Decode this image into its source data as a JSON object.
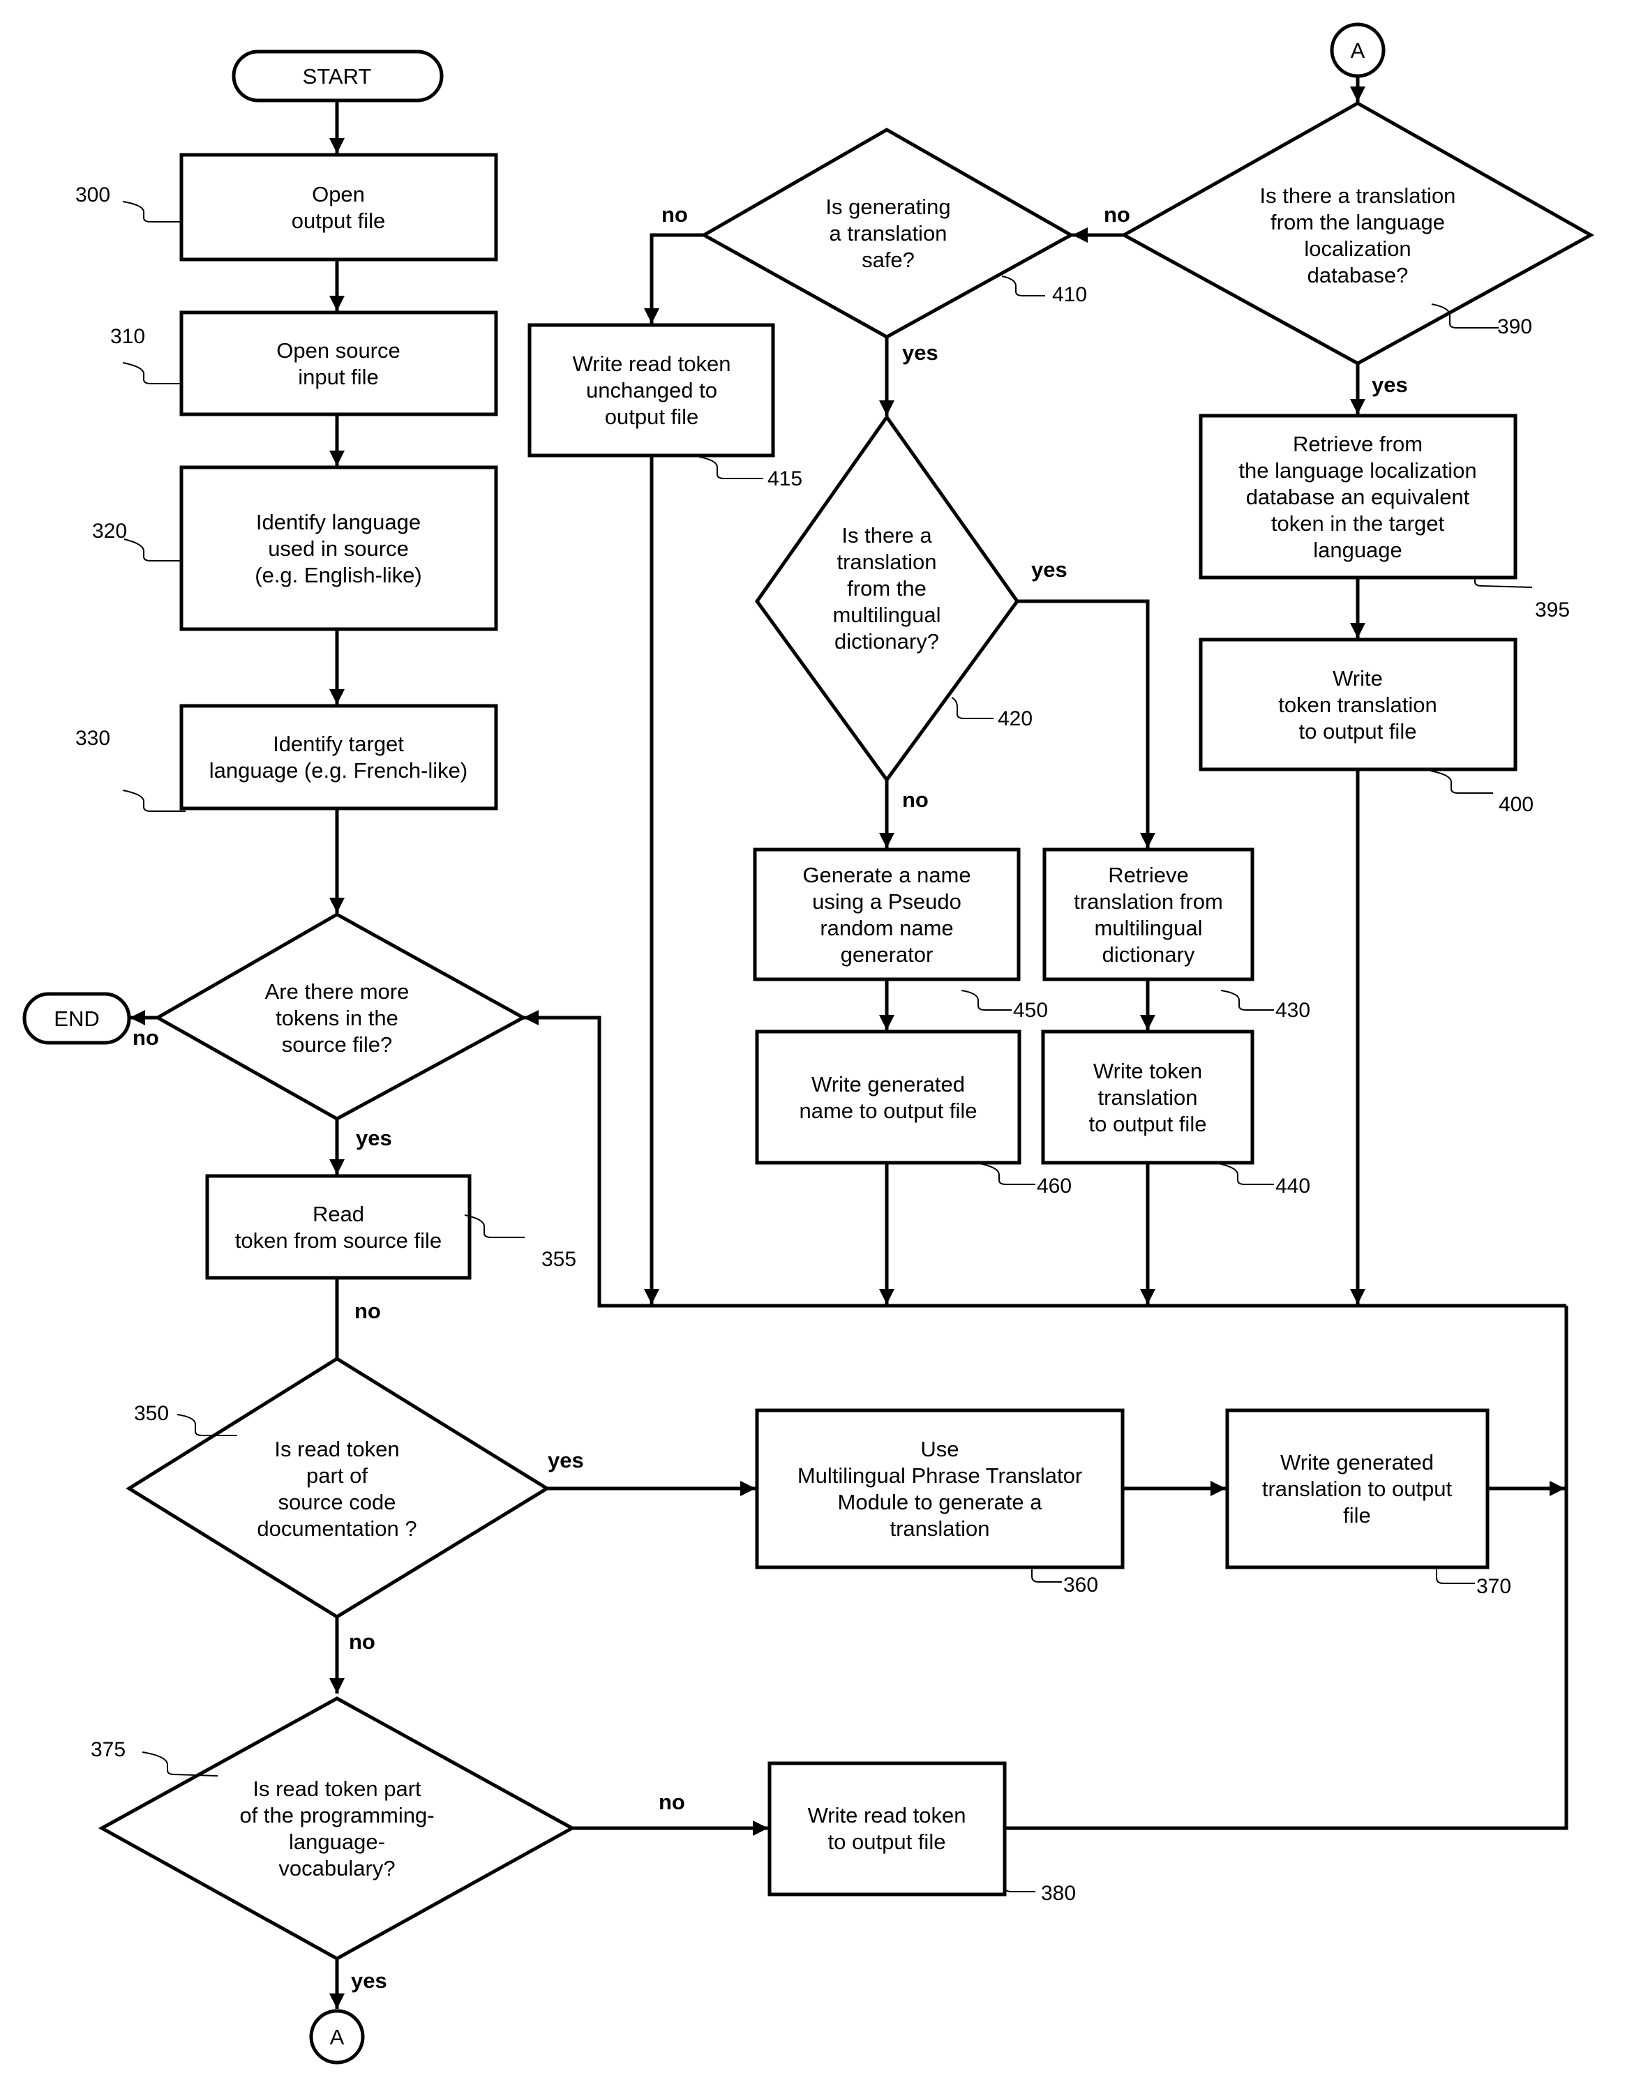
{
  "diagram": {
    "type": "flowchart",
    "colors": {
      "stroke": "#000000",
      "background": "#ffffff"
    },
    "terminals": {
      "start": "START",
      "end": "END",
      "connector_bottom": "A",
      "connector_top": "A"
    },
    "steps": {
      "s300": {
        "ref": "300",
        "lines": [
          "Open",
          "output file"
        ]
      },
      "s310": {
        "ref": "310",
        "lines": [
          "Open source",
          "input file"
        ]
      },
      "s320": {
        "ref": "320",
        "lines": [
          "Identify language",
          "used in source",
          "(e.g. English-like)"
        ]
      },
      "s330": {
        "ref": "330",
        "lines": [
          "Identify target",
          "language (e.g. French-like)"
        ]
      },
      "s340": {
        "ref": "",
        "lines": [
          "Are there more",
          "tokens in the",
          "source file?"
        ]
      },
      "s355": {
        "ref": "355",
        "lines": [
          "Read",
          "token from source file"
        ]
      },
      "s350": {
        "ref": "350",
        "lines": [
          "Is read token",
          "part of",
          "source code",
          "documentation ?"
        ]
      },
      "s360": {
        "ref": "360",
        "lines": [
          "Use",
          "Multilingual Phrase Translator",
          "Module to generate a",
          "translation"
        ]
      },
      "s370": {
        "ref": "370",
        "lines": [
          "Write generated",
          "translation to output",
          "file"
        ]
      },
      "s375": {
        "ref": "375",
        "lines": [
          "Is read token part",
          "of the programming-",
          "language-",
          "vocabulary?"
        ]
      },
      "s380": {
        "ref": "380",
        "lines": [
          "Write read token",
          "to output file"
        ]
      },
      "s390": {
        "ref": "390",
        "lines": [
          "Is there a translation",
          "from the language",
          "localization",
          "database?"
        ]
      },
      "s395": {
        "ref": "395",
        "lines": [
          "Retrieve from",
          "the language localization",
          "database an equivalent",
          "token in the target",
          "language"
        ]
      },
      "s400": {
        "ref": "400",
        "lines": [
          "Write",
          "token translation",
          "to output file"
        ]
      },
      "s410": {
        "ref": "410",
        "lines": [
          "Is generating",
          "a translation",
          "safe?"
        ]
      },
      "s415": {
        "ref": "415",
        "lines": [
          "Write read token",
          "unchanged to",
          "output  file"
        ]
      },
      "s420": {
        "ref": "420",
        "lines": [
          "Is there a",
          "translation",
          "from the",
          "multilingual",
          "dictionary?"
        ]
      },
      "s430": {
        "ref": "430",
        "lines": [
          "Retrieve",
          "translation from",
          "multilingual",
          "dictionary"
        ]
      },
      "s440": {
        "ref": "440",
        "lines": [
          "Write token",
          "translation",
          "to output file"
        ]
      },
      "s450": {
        "ref": "450",
        "lines": [
          "Generate a name",
          "using a Pseudo",
          "random name",
          "generator"
        ]
      },
      "s460": {
        "ref": "460",
        "lines": [
          "Write generated",
          "name to output file"
        ]
      }
    },
    "edge_labels": {
      "yes": "yes",
      "no": "no"
    }
  }
}
